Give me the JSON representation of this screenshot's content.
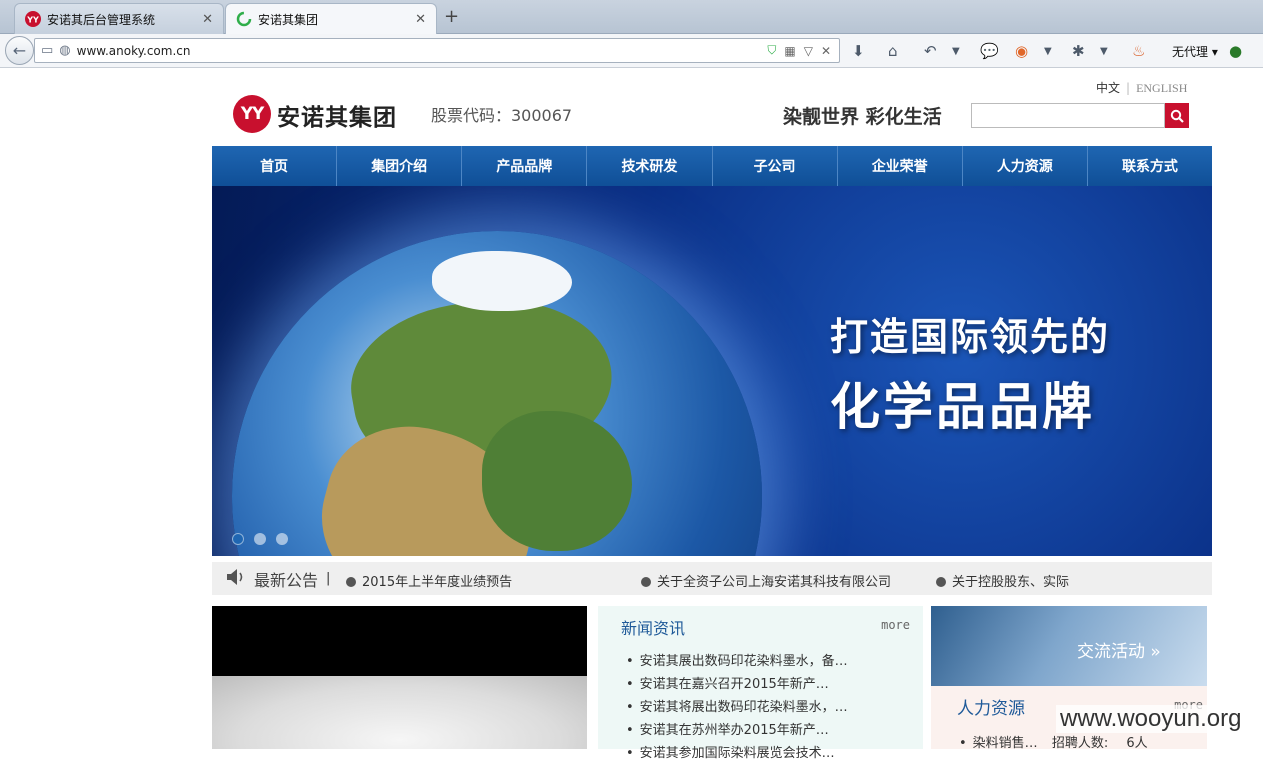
{
  "browser": {
    "tabs": [
      {
        "label": "安诺其后台管理系统",
        "active": false
      },
      {
        "label": "安诺其集团",
        "active": true
      }
    ],
    "url": "www.anoky.com.cn",
    "proxy_label": "无代理"
  },
  "header": {
    "lang_cn": "中文",
    "lang_en": "ENGLISH",
    "logo_mark": "YY",
    "company_name": "安诺其集团",
    "stock_code": "股票代码：300067",
    "slogan": "染靓世界 彩化生活",
    "search_placeholder": ""
  },
  "nav": [
    "首页",
    "集团介绍",
    "产品品牌",
    "技术研发",
    "子公司",
    "企业荣誉",
    "人力资源",
    "联系方式"
  ],
  "banner": {
    "line1": "打造国际领先的",
    "line2": "化学品品牌",
    "slide_count": 3,
    "active_slide": 1
  },
  "notice": {
    "title": "最新公告",
    "items": [
      "2015年上半年度业绩预告",
      "关于全资子公司上海安诺其科技有限公司",
      "关于控股股东、实际"
    ]
  },
  "news": {
    "title": "新闻资讯",
    "more": "more",
    "items": [
      "安诺其展出数码印花染料墨水，备…",
      "安诺其在嘉兴召开2015年新产…",
      "安诺其将展出数码印花染料墨水，…",
      "安诺其在苏州举办2015年新产…",
      "安诺其参加国际染料展览会技术…"
    ]
  },
  "hr": {
    "banner_label": "交流活动 »",
    "title": "人力资源",
    "more": "more",
    "job": "染料销售…",
    "count_label": "招聘人数:",
    "count_value": "6人"
  },
  "watermark": "www.wooyun.org",
  "colors": {
    "brand_red": "#c8102e",
    "nav_blue": "#1a5fa8",
    "heading_blue": "#1f5a99"
  }
}
